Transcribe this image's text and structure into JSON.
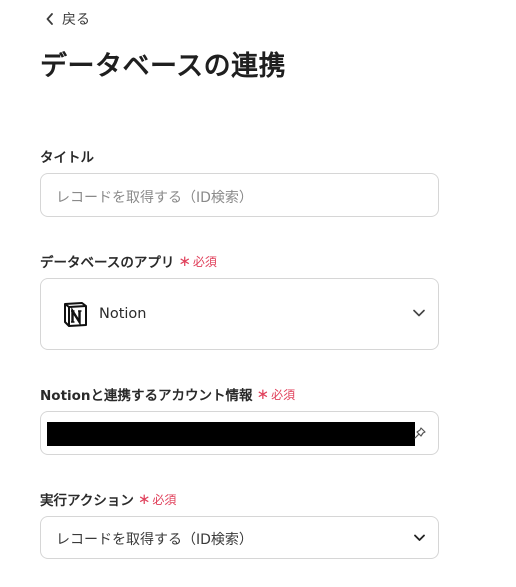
{
  "nav": {
    "back_label": "戻る"
  },
  "page": {
    "title": "データベースの連携"
  },
  "title_field": {
    "label": "タイトル",
    "placeholder": "レコードを取得する（ID検索）"
  },
  "app_field": {
    "label": "データベースのアプリ",
    "required": "必須",
    "selected_app": "Notion",
    "icon": "notion-logo"
  },
  "account_field": {
    "label": "Notionと連携するアカウント情報",
    "required": "必須",
    "value_redacted": true
  },
  "action_field": {
    "label": "実行アクション",
    "required": "必須",
    "selected": "レコードを取得する（ID検索）"
  },
  "colors": {
    "required_accent": "#e0405b",
    "border": "#d6d6d6",
    "text": "#2b2b2b"
  }
}
